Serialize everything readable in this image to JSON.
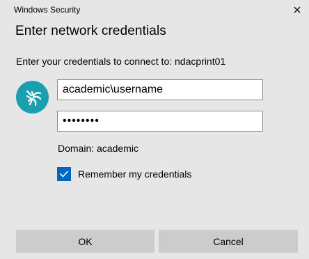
{
  "window": {
    "app_title": "Windows Security",
    "close_glyph": "✕"
  },
  "dialog": {
    "heading": "Enter network credentials",
    "prompt": "Enter your credentials to connect to: ndacprint01",
    "username_value": "academic\\username",
    "password_value": "••••••••",
    "domain_text": "Domain: academic",
    "remember_label": "Remember my credentials",
    "remember_checked": true
  },
  "buttons": {
    "ok_label": "OK",
    "cancel_label": "Cancel"
  },
  "icons": {
    "avatar": "security-key-avatar-icon",
    "close": "close-icon",
    "checkmark": "checkmark-icon"
  },
  "colors": {
    "background": "#e6e6e6",
    "avatar": "#1b9fb0",
    "checkbox": "#0067c0",
    "button": "#cccccc"
  }
}
